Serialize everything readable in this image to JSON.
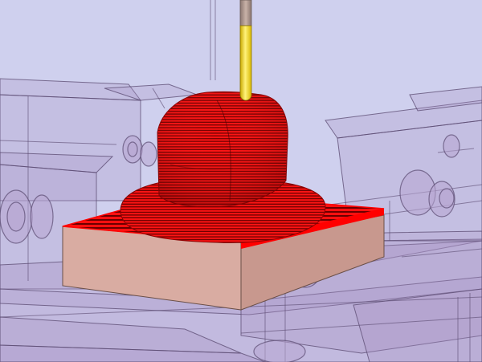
{
  "viewport": {
    "scene": "cnc-toolpath-simulation",
    "background_color": "#cfd0ee",
    "colors": {
      "fixture_fill": "#a892c4",
      "fixture_edge": "#5a4a70",
      "stock_side": "#d9aca2",
      "stock_side_dark": "#c8988e",
      "toolpath": "#ff0000",
      "toolpath_shadow": "#7a0000",
      "tool_shank": "#b39a90",
      "tool_tip": "#f7e400"
    },
    "objects": [
      {
        "name": "fixture-plate",
        "icon": "fixture-icon"
      },
      {
        "name": "workpiece-stock",
        "icon": "stock-block-icon"
      },
      {
        "name": "roughing-toolpath",
        "icon": "toolpath-icon"
      },
      {
        "name": "cutting-tool",
        "icon": "ball-end-mill-icon"
      }
    ]
  }
}
